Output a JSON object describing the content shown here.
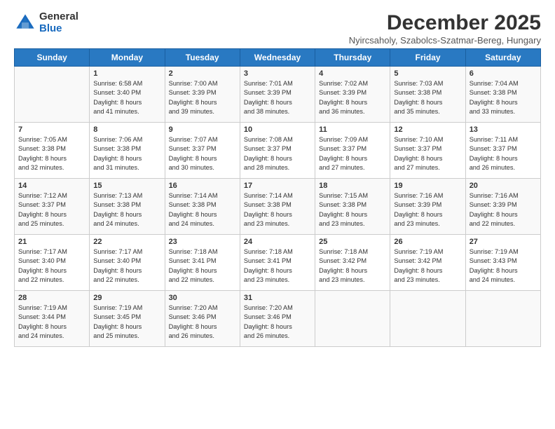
{
  "logo": {
    "general": "General",
    "blue": "Blue"
  },
  "title": "December 2025",
  "subtitle": "Nyircsaholy, Szabolcs-Szatmar-Bereg, Hungary",
  "days_header": [
    "Sunday",
    "Monday",
    "Tuesday",
    "Wednesday",
    "Thursday",
    "Friday",
    "Saturday"
  ],
  "weeks": [
    [
      {
        "day": "",
        "content": ""
      },
      {
        "day": "1",
        "content": "Sunrise: 6:58 AM\nSunset: 3:40 PM\nDaylight: 8 hours\nand 41 minutes."
      },
      {
        "day": "2",
        "content": "Sunrise: 7:00 AM\nSunset: 3:39 PM\nDaylight: 8 hours\nand 39 minutes."
      },
      {
        "day": "3",
        "content": "Sunrise: 7:01 AM\nSunset: 3:39 PM\nDaylight: 8 hours\nand 38 minutes."
      },
      {
        "day": "4",
        "content": "Sunrise: 7:02 AM\nSunset: 3:39 PM\nDaylight: 8 hours\nand 36 minutes."
      },
      {
        "day": "5",
        "content": "Sunrise: 7:03 AM\nSunset: 3:38 PM\nDaylight: 8 hours\nand 35 minutes."
      },
      {
        "day": "6",
        "content": "Sunrise: 7:04 AM\nSunset: 3:38 PM\nDaylight: 8 hours\nand 33 minutes."
      }
    ],
    [
      {
        "day": "7",
        "content": "Sunrise: 7:05 AM\nSunset: 3:38 PM\nDaylight: 8 hours\nand 32 minutes."
      },
      {
        "day": "8",
        "content": "Sunrise: 7:06 AM\nSunset: 3:38 PM\nDaylight: 8 hours\nand 31 minutes."
      },
      {
        "day": "9",
        "content": "Sunrise: 7:07 AM\nSunset: 3:37 PM\nDaylight: 8 hours\nand 30 minutes."
      },
      {
        "day": "10",
        "content": "Sunrise: 7:08 AM\nSunset: 3:37 PM\nDaylight: 8 hours\nand 28 minutes."
      },
      {
        "day": "11",
        "content": "Sunrise: 7:09 AM\nSunset: 3:37 PM\nDaylight: 8 hours\nand 27 minutes."
      },
      {
        "day": "12",
        "content": "Sunrise: 7:10 AM\nSunset: 3:37 PM\nDaylight: 8 hours\nand 27 minutes."
      },
      {
        "day": "13",
        "content": "Sunrise: 7:11 AM\nSunset: 3:37 PM\nDaylight: 8 hours\nand 26 minutes."
      }
    ],
    [
      {
        "day": "14",
        "content": "Sunrise: 7:12 AM\nSunset: 3:37 PM\nDaylight: 8 hours\nand 25 minutes."
      },
      {
        "day": "15",
        "content": "Sunrise: 7:13 AM\nSunset: 3:38 PM\nDaylight: 8 hours\nand 24 minutes."
      },
      {
        "day": "16",
        "content": "Sunrise: 7:14 AM\nSunset: 3:38 PM\nDaylight: 8 hours\nand 24 minutes."
      },
      {
        "day": "17",
        "content": "Sunrise: 7:14 AM\nSunset: 3:38 PM\nDaylight: 8 hours\nand 23 minutes."
      },
      {
        "day": "18",
        "content": "Sunrise: 7:15 AM\nSunset: 3:38 PM\nDaylight: 8 hours\nand 23 minutes."
      },
      {
        "day": "19",
        "content": "Sunrise: 7:16 AM\nSunset: 3:39 PM\nDaylight: 8 hours\nand 23 minutes."
      },
      {
        "day": "20",
        "content": "Sunrise: 7:16 AM\nSunset: 3:39 PM\nDaylight: 8 hours\nand 22 minutes."
      }
    ],
    [
      {
        "day": "21",
        "content": "Sunrise: 7:17 AM\nSunset: 3:40 PM\nDaylight: 8 hours\nand 22 minutes."
      },
      {
        "day": "22",
        "content": "Sunrise: 7:17 AM\nSunset: 3:40 PM\nDaylight: 8 hours\nand 22 minutes."
      },
      {
        "day": "23",
        "content": "Sunrise: 7:18 AM\nSunset: 3:41 PM\nDaylight: 8 hours\nand 22 minutes."
      },
      {
        "day": "24",
        "content": "Sunrise: 7:18 AM\nSunset: 3:41 PM\nDaylight: 8 hours\nand 23 minutes."
      },
      {
        "day": "25",
        "content": "Sunrise: 7:18 AM\nSunset: 3:42 PM\nDaylight: 8 hours\nand 23 minutes."
      },
      {
        "day": "26",
        "content": "Sunrise: 7:19 AM\nSunset: 3:42 PM\nDaylight: 8 hours\nand 23 minutes."
      },
      {
        "day": "27",
        "content": "Sunrise: 7:19 AM\nSunset: 3:43 PM\nDaylight: 8 hours\nand 24 minutes."
      }
    ],
    [
      {
        "day": "28",
        "content": "Sunrise: 7:19 AM\nSunset: 3:44 PM\nDaylight: 8 hours\nand 24 minutes."
      },
      {
        "day": "29",
        "content": "Sunrise: 7:19 AM\nSunset: 3:45 PM\nDaylight: 8 hours\nand 25 minutes."
      },
      {
        "day": "30",
        "content": "Sunrise: 7:20 AM\nSunset: 3:46 PM\nDaylight: 8 hours\nand 26 minutes."
      },
      {
        "day": "31",
        "content": "Sunrise: 7:20 AM\nSunset: 3:46 PM\nDaylight: 8 hours\nand 26 minutes."
      },
      {
        "day": "",
        "content": ""
      },
      {
        "day": "",
        "content": ""
      },
      {
        "day": "",
        "content": ""
      }
    ]
  ]
}
